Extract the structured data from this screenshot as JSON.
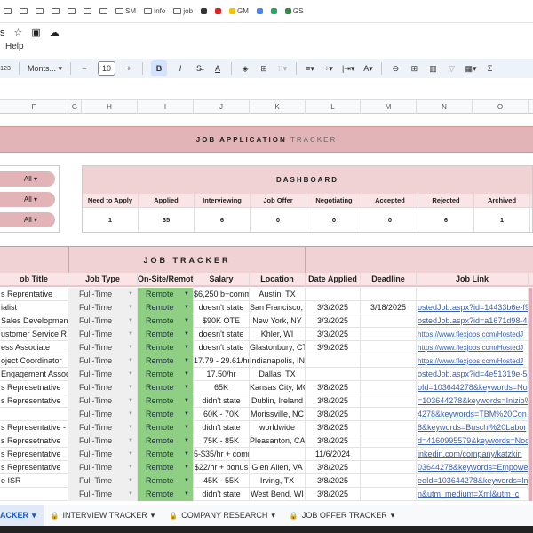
{
  "bookmarks": [
    "",
    "",
    "",
    "",
    "",
    "",
    "",
    "SM",
    "Info",
    "job",
    "",
    "",
    "GM",
    "",
    "",
    "GS"
  ],
  "title_fragment": "s",
  "menu": {
    "help": "Help"
  },
  "toolbar": {
    "format": "123",
    "font": "Monts...",
    "font_size": "10",
    "bold": "B",
    "italic": "I"
  },
  "columns": [
    "F",
    "G",
    "H",
    "I",
    "J",
    "K",
    "L",
    "M",
    "N",
    "O"
  ],
  "banner": {
    "bold": "JOB APPLICATION",
    "light": "TRACKER"
  },
  "filters": [
    "All",
    "All",
    "All"
  ],
  "dashboard": {
    "title": "DASHBOARD",
    "labels": [
      "Need to Apply",
      "Applied",
      "Interviewing",
      "Job Offer",
      "Negotiating",
      "Accepted",
      "Rejected",
      "Archived"
    ],
    "values": [
      "1",
      "35",
      "6",
      "0",
      "0",
      "0",
      "6",
      "1"
    ]
  },
  "job_tracker": {
    "title": "JOB TRACKER",
    "headers": [
      "ob Title",
      "Job Type",
      "On-Site/Remote",
      "Salary",
      "Location",
      "Date Applied",
      "Deadline",
      "Job Link"
    ],
    "rows": [
      [
        "s Reprentative",
        "Full-Time",
        "Remote",
        "$6,250 b+comm",
        "Austin, TX",
        "",
        "",
        ""
      ],
      [
        "ialist",
        "Full-Time",
        "Remote",
        "doesn't state",
        "San Francisco, C",
        "3/3/2025",
        "3/18/2025",
        "ostedJob.aspx?id=14433b6e-f9"
      ],
      [
        "Sales Development",
        "Full-Time",
        "Remote",
        "$90K OTE",
        "New York, NY",
        "3/3/2025",
        "",
        "ostedJob.aspx?id=a1671d98-4"
      ],
      [
        "ustomer Service R",
        "Full-Time",
        "Remote",
        "doesn't state",
        "Khler, WI",
        "3/3/2025",
        "",
        "https://www.flexjobs.com/HostedJ"
      ],
      [
        "ess Associate",
        "Full-Time",
        "Remote",
        "doesn't state",
        "Glastonbury, CT",
        "3/9/2025",
        "",
        "https://www.flexjobs.com/HostedJ"
      ],
      [
        "oject Coordinator",
        "Full-Time",
        "Remote",
        "17.79 - 29.61/hr",
        "Indianapolis, IN",
        "",
        "",
        "https://www.flexjobs.com/HostedJ"
      ],
      [
        "Engagement Assoc",
        "Full-Time",
        "Remote",
        "17.50/hr",
        "Dallas, TX",
        "",
        "",
        "ostedJob.aspx?id=4e51319e-5a"
      ],
      [
        "s Represetnative",
        "Full-Time",
        "Remote",
        "65K",
        "Kansas City, MO",
        "3/8/2025",
        "",
        "oId=103644278&keywords=No"
      ],
      [
        "s Representative",
        "Full-Time",
        "Remote",
        "didn't state",
        "Dublin, Ireland",
        "3/8/2025",
        "",
        "=103644278&keywords=Inizio%"
      ],
      [
        "",
        "Full-Time",
        "Remote",
        "60K - 70K",
        "Morissville, NC",
        "3/8/2025",
        "",
        "4278&keywords=TBM%20Con"
      ],
      [
        "s Representative - I",
        "Full-Time",
        "Remote",
        "didn't state",
        "worldwide",
        "3/8/2025",
        "",
        "8&keywords=Buschi%20Labor"
      ],
      [
        "s Represetnative",
        "Full-Time",
        "Remote",
        "75K - 85K",
        "Pleasanton, CA",
        "3/8/2025",
        "",
        "d=4160995579&keywords=Noc"
      ],
      [
        "s Representative",
        "Full-Time",
        "Remote",
        "5-$35/hr + comm",
        "",
        "11/6/2024",
        "",
        "inkedin.com/company/katzkin"
      ],
      [
        "s Representative",
        "Full-Time",
        "Remote",
        "$22/hr + bonus",
        "Glen Allen, VA",
        "3/8/2025",
        "",
        "03644278&keywords=Empowe"
      ],
      [
        "e ISR",
        "Full-Time",
        "Remote",
        "45K - 55K",
        "Irving, TX",
        "3/8/2025",
        "",
        "eoId=103644278&keywords=Im"
      ],
      [
        "",
        "Full-Time",
        "Remote",
        "didn't state",
        "West Bend, WI",
        "3/8/2025",
        "",
        "n&utm_medium=Xml&utm_c"
      ]
    ]
  },
  "sheet_tabs": [
    "ACKER",
    "INTERVIEW TRACKER",
    "COMPANY RESEARCH",
    "JOB OFFER TRACKER"
  ],
  "colors": {
    "banner": "#e2b3b7",
    "header": "#f0d2d5",
    "remote": "#8fcf83",
    "link": "#3a5fb0"
  }
}
